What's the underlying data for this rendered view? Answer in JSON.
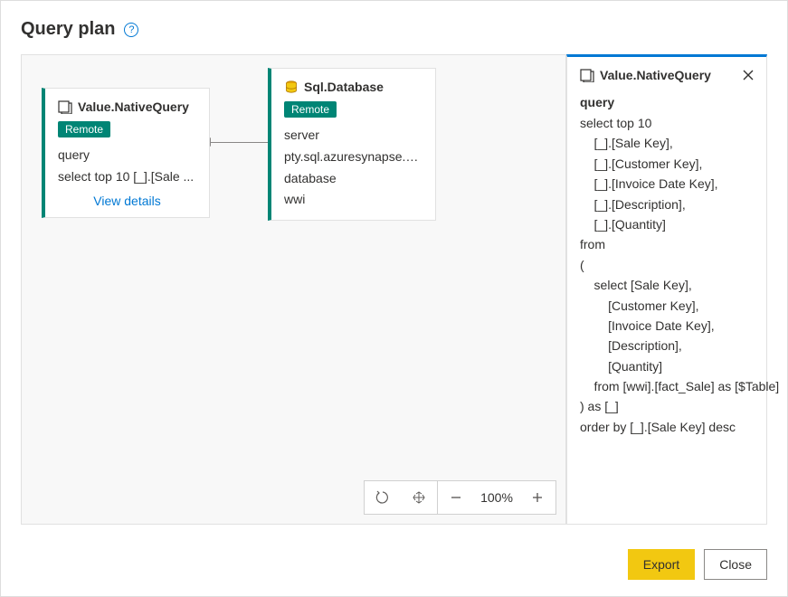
{
  "dialog": {
    "title": "Query plan"
  },
  "nodes": {
    "native": {
      "title": "Value.NativeQuery",
      "badge": "Remote",
      "row1_label": "query",
      "row1_value": "select top 10 [_].[Sale ...",
      "view_details": "View details"
    },
    "sql": {
      "title": "Sql.Database",
      "badge": "Remote",
      "row1_label": "server",
      "row1_value": "pty.sql.azuresynapse.net",
      "row2_label": "database",
      "row2_value": "wwi"
    }
  },
  "zoom": {
    "percent": "100%"
  },
  "details": {
    "title": "Value.NativeQuery",
    "section": "query",
    "query_text": "select top 10\n    [_].[Sale Key],\n    [_].[Customer Key],\n    [_].[Invoice Date Key],\n    [_].[Description],\n    [_].[Quantity]\nfrom\n(\n    select [Sale Key],\n        [Customer Key],\n        [Invoice Date Key],\n        [Description],\n        [Quantity]\n    from [wwi].[fact_Sale] as [$Table]\n) as [_]\norder by [_].[Sale Key] desc"
  },
  "footer": {
    "export": "Export",
    "close": "Close"
  }
}
